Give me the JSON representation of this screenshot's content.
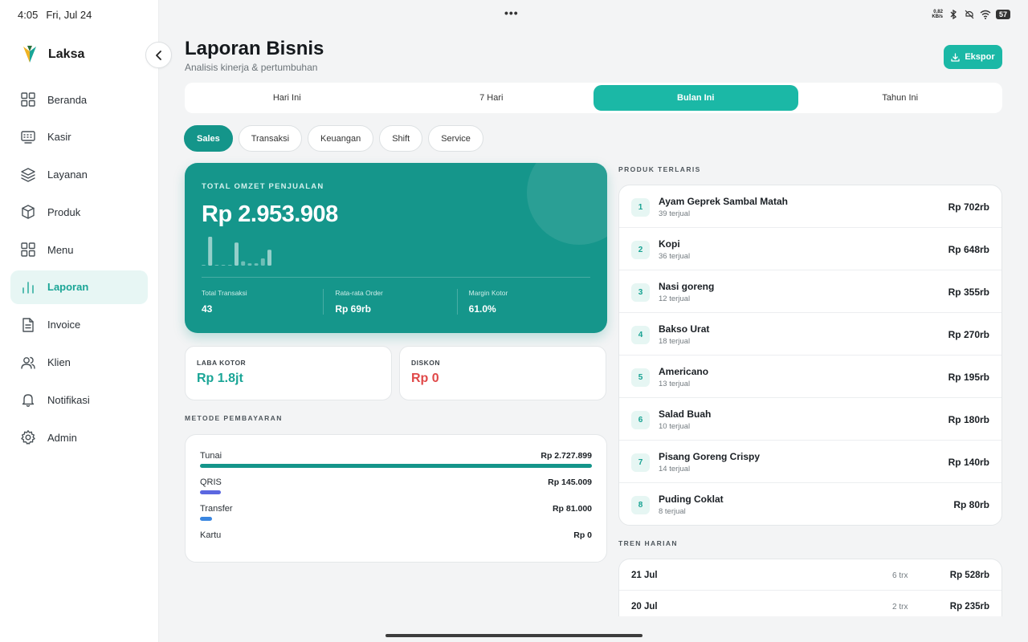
{
  "status_bar": {
    "time": "4:05",
    "date": "Fri, Jul 24",
    "net_speed": "0.82",
    "net_unit": "KB/s",
    "battery": "57"
  },
  "sidebar": {
    "brand": "Laksa",
    "items": [
      {
        "label": "Beranda",
        "icon": "grid-icon"
      },
      {
        "label": "Kasir",
        "icon": "cash-register-icon"
      },
      {
        "label": "Layanan",
        "icon": "layers-icon"
      },
      {
        "label": "Produk",
        "icon": "box-icon"
      },
      {
        "label": "Menu",
        "icon": "grid-icon"
      },
      {
        "label": "Laporan",
        "icon": "bar-chart-icon",
        "active": true
      },
      {
        "label": "Invoice",
        "icon": "document-icon"
      },
      {
        "label": "Klien",
        "icon": "users-icon"
      },
      {
        "label": "Notifikasi",
        "icon": "bell-icon"
      },
      {
        "label": "Admin",
        "icon": "gear-icon"
      }
    ]
  },
  "header": {
    "title": "Laporan Bisnis",
    "subtitle": "Analisis kinerja & pertumbuhan",
    "export_label": "Ekspor"
  },
  "period_tabs": [
    "Hari Ini",
    "7 Hari",
    "Bulan Ini",
    "Tahun Ini"
  ],
  "period_active": "Bulan Ini",
  "report_tabs": [
    "Sales",
    "Transaksi",
    "Keuangan",
    "Shift",
    "Service"
  ],
  "report_active": "Sales",
  "hero": {
    "label": "TOTAL OMZET PENJUALAN",
    "value": "Rp 2.953.908",
    "spark_values": [
      0.02,
      1.0,
      0.02,
      0.02,
      0.02,
      0.8,
      0.15,
      0.08,
      0.08,
      0.25,
      0.55
    ],
    "stats": [
      {
        "label": "Total Transaksi",
        "value": "43"
      },
      {
        "label": "Rata-rata Order",
        "value": "Rp 69rb"
      },
      {
        "label": "Margin Kotor",
        "value": "61.0%"
      }
    ]
  },
  "summary": {
    "gross_profit_label": "LABA KOTOR",
    "gross_profit_value": "Rp 1.8jt",
    "discount_label": "DISKON",
    "discount_value": "Rp 0"
  },
  "payment": {
    "title": "METODE PEMBAYARAN",
    "methods": [
      {
        "name": "Tunai",
        "amount": "Rp 2.727.899",
        "share": 1.0,
        "color": "#14958a"
      },
      {
        "name": "QRIS",
        "amount": "Rp 145.009",
        "share": 0.053,
        "color": "#5b67e0"
      },
      {
        "name": "Transfer",
        "amount": "Rp 81.000",
        "share": 0.03,
        "color": "#3a86e0"
      },
      {
        "name": "Kartu",
        "amount": "Rp 0",
        "share": 0,
        "color": "#999999"
      }
    ]
  },
  "products": {
    "title": "PRODUK TERLARIS",
    "items": [
      {
        "rank": "1",
        "name": "Ayam Geprek Sambal Matah",
        "sold": "39 terjual",
        "revenue": "Rp 702rb"
      },
      {
        "rank": "2",
        "name": "Kopi",
        "sold": "36 terjual",
        "revenue": "Rp 648rb"
      },
      {
        "rank": "3",
        "name": "Nasi goreng",
        "sold": "12 terjual",
        "revenue": "Rp 355rb"
      },
      {
        "rank": "4",
        "name": "Bakso Urat",
        "sold": "18 terjual",
        "revenue": "Rp 270rb"
      },
      {
        "rank": "5",
        "name": "Americano",
        "sold": "13 terjual",
        "revenue": "Rp 195rb"
      },
      {
        "rank": "6",
        "name": "Salad Buah",
        "sold": "10 terjual",
        "revenue": "Rp 180rb"
      },
      {
        "rank": "7",
        "name": "Pisang Goreng Crispy",
        "sold": "14 terjual",
        "revenue": "Rp 140rb"
      },
      {
        "rank": "8",
        "name": "Puding Coklat",
        "sold": "8 terjual",
        "revenue": "Rp 80rb"
      }
    ]
  },
  "trend": {
    "title": "TREN HARIAN",
    "rows": [
      {
        "date": "21 Jul",
        "trx": "6 trx",
        "revenue": "Rp 528rb"
      },
      {
        "date": "20 Jul",
        "trx": "2 trx",
        "revenue": "Rp 235rb"
      }
    ]
  },
  "colors": {
    "accent": "#1bb8a6",
    "accent_dark": "#14958a",
    "profit": "#1aa596",
    "discount": "#e04848"
  }
}
